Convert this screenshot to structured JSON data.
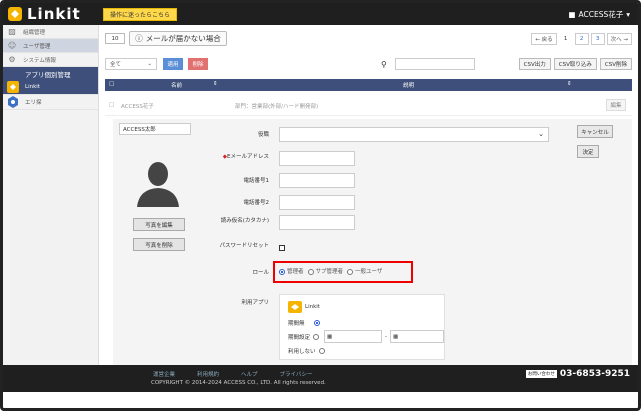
{
  "header": {
    "logo_text": "Linkit",
    "help_button": "操作に迷ったらこちら",
    "user_name": "ACCESS花子"
  },
  "sidebar": {
    "items": [
      {
        "label": "組織管理"
      },
      {
        "label": "ユーザ管理"
      },
      {
        "label": "システム情報"
      }
    ],
    "section_title": "アプリ個別管理",
    "apps": [
      {
        "label": "Linkit"
      },
      {
        "label": "エリ探"
      }
    ]
  },
  "toolbar": {
    "per_page": "10",
    "mail_button": "メールが届かない場合",
    "pager": {
      "prev": "← 戻る",
      "pages": [
        "1",
        "2",
        "3"
      ],
      "next": "次へ →"
    },
    "filter_value": "全て",
    "apply_button": "適用",
    "delete_button": "削除",
    "csv_export": "CSV出力",
    "csv_import": "CSV取り込み",
    "csv_delete": "CSV削除"
  },
  "table": {
    "col_name": "名前",
    "col_desc": "説明",
    "row": {
      "name": "ACCESS花子",
      "desc": "部門：営業部(外部/ハード開発部)",
      "edit": "編集"
    }
  },
  "detail": {
    "name_value": "ACCESS太郎",
    "photo_upload": "写真を編集",
    "photo_delete": "写真を削除",
    "labels": {
      "position": "役職",
      "email": "Eメールアドレス",
      "tel1": "電話番号1",
      "tel2": "電話番号2",
      "kana": "読み仮名(カタカナ)",
      "password_reset": "パスワードリセット",
      "role": "ロール",
      "apps": "利用アプリ"
    },
    "roles": [
      "管理者",
      "サブ管理者",
      "一般ユーザ"
    ],
    "selected_role": "管理者",
    "cancel": "キャンセル",
    "confirm": "決定",
    "app": {
      "name": "Linkit",
      "row1": "期間無",
      "row2": "期間設定",
      "row3": "利用しない"
    }
  },
  "footer": {
    "links": [
      "運営企業",
      "利用規約",
      "ヘルプ",
      "プライバシー"
    ],
    "copyright": "COPYRIGHT © 2014-2024 ACCESS CO., LTD. All rights reserved.",
    "phone_label": "お問い合わせ",
    "phone": "03-6853-9251"
  }
}
